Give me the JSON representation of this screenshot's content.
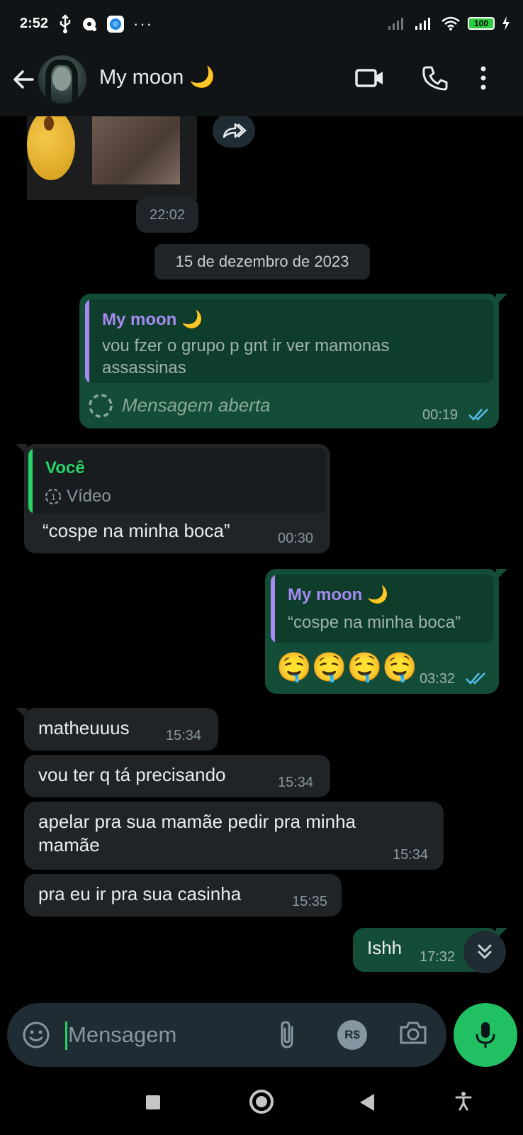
{
  "status_bar": {
    "time": "2:52",
    "battery": "100"
  },
  "header": {
    "contact_name": "My moon 🌙",
    "icons": [
      "back-arrow-icon",
      "video-call-icon",
      "phone-icon",
      "more-vert-icon"
    ]
  },
  "chat": {
    "media_time": "22:02",
    "date_separator": "15 de dezembro de 2023",
    "messages": [
      {
        "direction": "outgoing",
        "quote_author": "My moon 🌙",
        "quote_text": "vou fzer o grupo p gnt ir ver mamonas assassinas",
        "text": "Mensagem aberta",
        "time": "00:19",
        "status": "read"
      },
      {
        "direction": "incoming",
        "quote_author": "Você",
        "quote_text": "Vídeo",
        "text": "“cospe na minha boca”",
        "time": "00:30"
      },
      {
        "direction": "outgoing",
        "quote_author": "My moon 🌙",
        "quote_text": "“cospe na minha boca”",
        "text": "🤤🤤🤤🤤",
        "time": "03:32",
        "status": "read"
      },
      {
        "direction": "incoming",
        "text": "matheuuus",
        "time": "15:34"
      },
      {
        "direction": "incoming",
        "text": "vou ter q tá precisando",
        "time": "15:34"
      },
      {
        "direction": "incoming",
        "text": "apelar pra sua mamãe pedir pra minha mamãe",
        "time": "15:34"
      },
      {
        "direction": "incoming",
        "text": "pra eu ir pra sua casinha",
        "time": "15:35"
      },
      {
        "direction": "outgoing",
        "text": "Ishh",
        "time": "17:32",
        "status": "read"
      }
    ]
  },
  "composer": {
    "placeholder": "Mensagem",
    "pay_label": "R$"
  },
  "colors": {
    "outgoing_bubble": "#144d37",
    "incoming_bubble": "#202427",
    "accent_green": "#21c063",
    "quote_author_purple": "#a58af0",
    "quote_author_green": "#25d366",
    "read_ticks": "#53bdeb"
  }
}
